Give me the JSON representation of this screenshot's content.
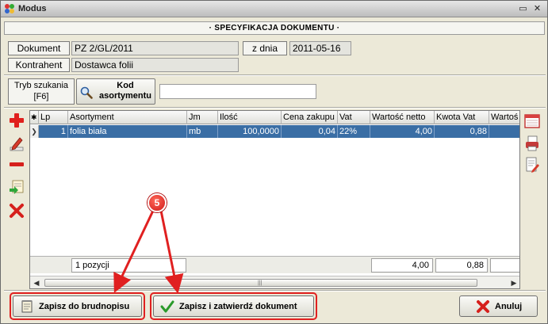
{
  "window": {
    "title": "Modus",
    "minimize_glyph": "▭",
    "close_glyph": "✕"
  },
  "header": {
    "title": "· SPECYFIKACJA DOKUMENTU ·"
  },
  "document": {
    "doc_label": "Dokument",
    "doc_value": "PZ 2/GL/2011",
    "date_label": "z dnia",
    "date_value": "2011-05-16",
    "contractor_label": "Kontrahent",
    "contractor_value": "Dostawca folii"
  },
  "search": {
    "mode_label_line1": "Tryb szukania",
    "mode_label_line2": "[F6]",
    "kod_line1": "Kod",
    "kod_line2": "asortymentu",
    "input_value": ""
  },
  "grid": {
    "row_indicator_header": "✱",
    "columns": [
      "Lp",
      "Asortyment",
      "Jm",
      "Ilość",
      "Cena zakupu",
      "Vat",
      "Wartość netto",
      "Kwota Vat",
      "Wartoś"
    ],
    "rows": [
      {
        "indicator": "❯",
        "lp": "1",
        "asortyment": "folia biała",
        "jm": "mb",
        "ilosc": "100,0000",
        "cena": "0,04",
        "vat": "22%",
        "netto": "4,00",
        "kwota_vat": "0,88",
        "wartosc": ""
      }
    ],
    "footer": {
      "count": "1 pozycji",
      "netto_total": "4,00",
      "vat_total": "0,88"
    }
  },
  "buttons": {
    "draft": "Zapisz do brudnopisu",
    "save_confirm": "Zapisz i zatwierdź dokument",
    "cancel": "Anuluj"
  },
  "annotation": {
    "badge": "5"
  },
  "colors": {
    "selection": "#3a6ea5",
    "highlight": "#e02020",
    "badge": "#d01818"
  }
}
